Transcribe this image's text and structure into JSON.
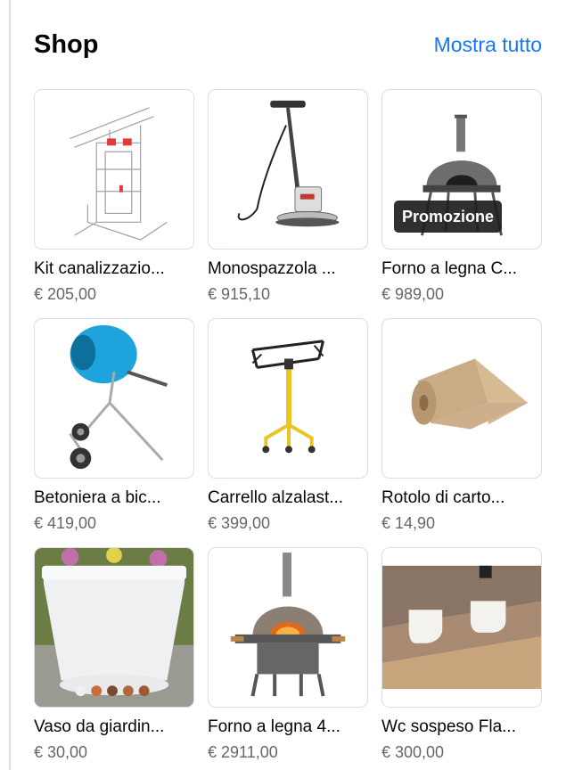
{
  "shop": {
    "title": "Shop",
    "see_all_label": "Mostra tutto",
    "accent_color": "#1877f2",
    "products": [
      {
        "name": "Kit canalizzazio...",
        "price": "€ 205,00",
        "icon": "duct-kit-icon"
      },
      {
        "name": "Monospazzola ...",
        "price": "€ 915,10",
        "icon": "floor-scrubber-icon"
      },
      {
        "name": "Forno a legna C...",
        "price": "€ 989,00",
        "icon": "pizza-oven-icon",
        "badge": "Promozione"
      },
      {
        "name": "Betoniera a bic...",
        "price": "€ 419,00",
        "icon": "cement-mixer-icon"
      },
      {
        "name": "Carrello alzalast...",
        "price": "€ 399,00",
        "icon": "panel-lift-icon"
      },
      {
        "name": "Rotolo di carto...",
        "price": "€ 14,90",
        "icon": "cardboard-roll-icon"
      },
      {
        "name": "Vaso da giardin...",
        "price": "€ 30,00",
        "icon": "garden-vase-icon"
      },
      {
        "name": "Forno a legna 4...",
        "price": "€ 2911,00",
        "icon": "wood-oven-icon"
      },
      {
        "name": "Wc sospeso Fla...",
        "price": "€ 300,00",
        "icon": "wall-toilet-icon"
      }
    ]
  }
}
